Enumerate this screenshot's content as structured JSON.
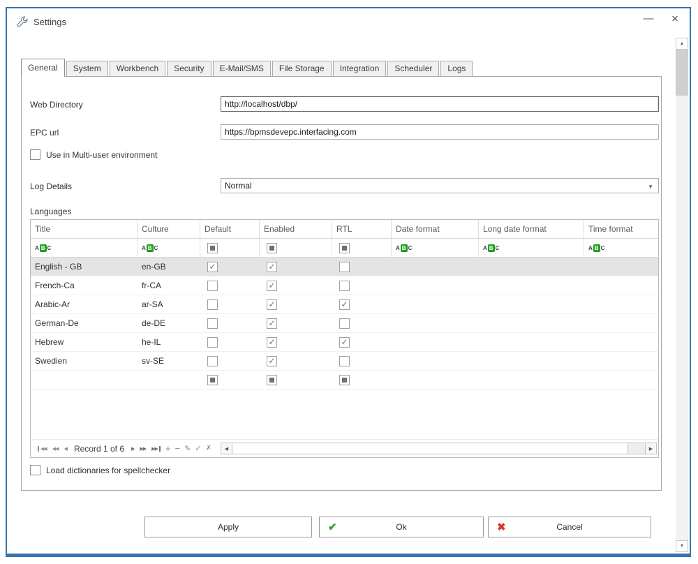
{
  "window": {
    "title": "Settings"
  },
  "icons": {
    "minimize": "—",
    "close": "×",
    "dropdown_arrow": "▼",
    "up_arrow": "▲",
    "down_arrow": "▼",
    "left_arrow": "◀",
    "right_arrow": "▶",
    "nav_first": "◀◀",
    "nav_prev_page": "◀◀",
    "nav_prev": "◀",
    "nav_next": "▶",
    "nav_next_page": "▶▶",
    "nav_last": "▶▶",
    "nav_add": "+",
    "nav_remove": "−",
    "nav_edit": "✎",
    "nav_commit": "✓",
    "nav_cancel": "✗",
    "ok_check": "✔",
    "cancel_cross": "✖",
    "checkmark": "✓",
    "abc_a": "A",
    "abc_b": "B",
    "abc_c": "C"
  },
  "tabs": [
    {
      "label": "General"
    },
    {
      "label": "System"
    },
    {
      "label": "Workbench"
    },
    {
      "label": "Security"
    },
    {
      "label": "E-Mail/SMS"
    },
    {
      "label": "File Storage"
    },
    {
      "label": "Integration"
    },
    {
      "label": "Scheduler"
    },
    {
      "label": "Logs"
    }
  ],
  "form": {
    "web_directory_label": "Web Directory",
    "web_directory_value": "http://localhost/dbp/",
    "epc_url_label": "EPC url",
    "epc_url_value": "https://bpmsdevepc.interfacing.com",
    "multiuser_label": "Use in Multi-user environment",
    "log_details_label": "Log Details",
    "log_details_value": "Normal",
    "languages_label": "Languages",
    "spellchecker_label": "Load dictionaries for spellchecker"
  },
  "grid": {
    "columns": [
      "Title",
      "Culture",
      "Default",
      "Enabled",
      "RTL",
      "Date format",
      "Long date format",
      "Time format"
    ],
    "filter_row": {
      "default": "mixed",
      "enabled": "mixed",
      "rtl": "mixed"
    },
    "new_row": {
      "default": "mixed",
      "enabled": "mixed",
      "rtl": "mixed"
    },
    "rows": [
      {
        "title": "English - GB",
        "culture": "en-GB",
        "default": true,
        "enabled": true,
        "rtl": false,
        "selected": true
      },
      {
        "title": "French-Ca",
        "culture": "fr-CA",
        "default": false,
        "enabled": true,
        "rtl": false
      },
      {
        "title": "Arabic-Ar",
        "culture": "ar-SA",
        "default": false,
        "enabled": true,
        "rtl": true
      },
      {
        "title": "German-De",
        "culture": "de-DE",
        "default": false,
        "enabled": true,
        "rtl": false
      },
      {
        "title": "Hebrew",
        "culture": "he-IL",
        "default": false,
        "enabled": true,
        "rtl": true
      },
      {
        "title": "Swedien",
        "culture": "sv-SE",
        "default": false,
        "enabled": true,
        "rtl": false
      }
    ],
    "navigator_text": "Record 1 of 6"
  },
  "buttons": {
    "apply": "Apply",
    "ok": "Ok",
    "cancel": "Cancel"
  },
  "colors": {
    "accent_border": "#3973ac",
    "ok_green": "#27a527",
    "cancel_red": "#d63a32",
    "abc_green": "#1f9d1f"
  }
}
